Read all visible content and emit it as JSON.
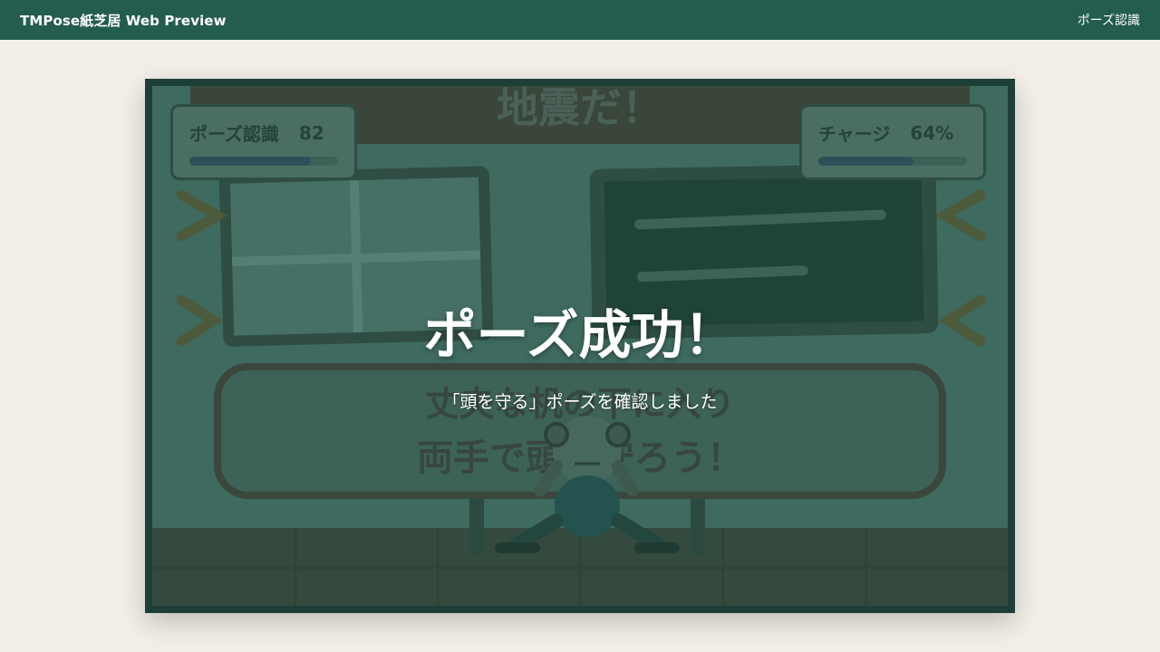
{
  "app": {
    "title": "TMPose紙芝居 Web Preview",
    "mode_link": "ポーズ認識"
  },
  "scene": {
    "banner_text": "地震だ！",
    "card_line1": "丈夫な机の下に入り",
    "card_line2": "両手で頭を守ろう！"
  },
  "hud": {
    "pose_label": "ポーズ認識",
    "pose_score": "82",
    "pose_level": 0.82,
    "charge_label": "チャージ",
    "charge_value": "64%",
    "charge_level": 0.64
  },
  "overlay": {
    "title": "ポーズ成功！",
    "subtitle": "「頭を守る」ポーズを確認しました"
  },
  "colors": {
    "topbar": "#245c4f",
    "page_background": "#f3efe8",
    "stage_frame": "#1e3f37",
    "scene_tint": "#3e6a5f"
  }
}
